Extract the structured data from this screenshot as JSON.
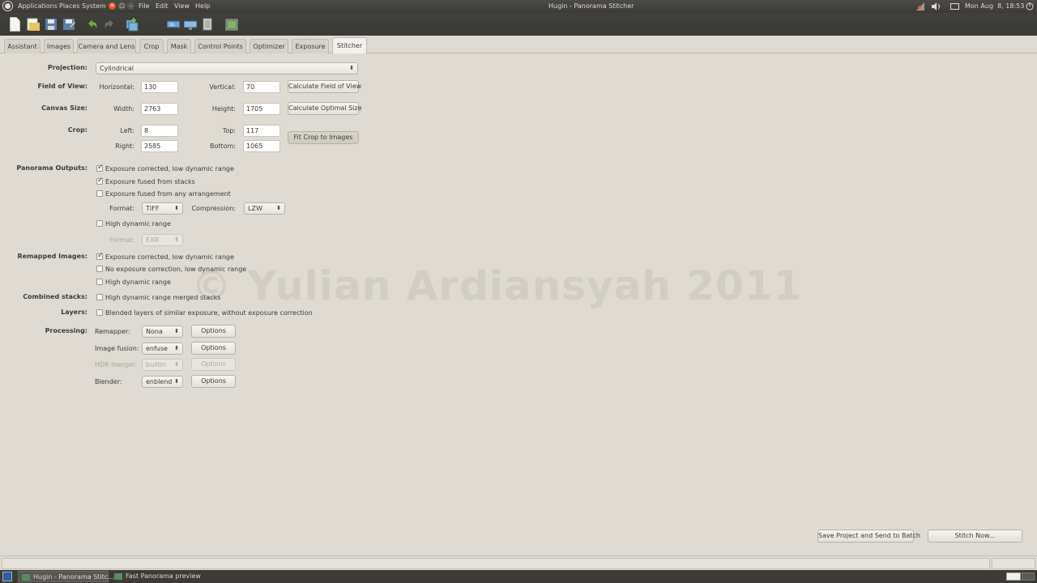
{
  "top_panel": {
    "menus": [
      "Applications",
      "Places",
      "System"
    ],
    "app_menus": [
      "File",
      "Edit",
      "View",
      "Help"
    ],
    "window_title": "Hugin - Panorama Stitcher",
    "clock": "Mon Aug  8, 18:53"
  },
  "tabs": [
    "Assistant",
    "Images",
    "Camera and Lens",
    "Crop",
    "Mask",
    "Control Points",
    "Optimizer",
    "Exposure",
    "Stitcher"
  ],
  "active_tab": "Stitcher",
  "projection": {
    "label": "Projection:",
    "value": "Cylindrical"
  },
  "field_of_view": {
    "label": "Field of View:",
    "horizontal_label": "Horizontal:",
    "horizontal": "130",
    "vertical_label": "Vertical:",
    "vertical": "70",
    "button": "Calculate Field of View"
  },
  "canvas_size": {
    "label": "Canvas Size:",
    "width_label": "Width:",
    "width": "2763",
    "height_label": "Height:",
    "height": "1705",
    "button": "Calculate Optimal Size"
  },
  "crop": {
    "label": "Crop:",
    "left_label": "Left:",
    "left": "8",
    "top_label": "Top:",
    "top": "117",
    "right_label": "Right:",
    "right": "2585",
    "bottom_label": "Bottom:",
    "bottom": "1065",
    "button": "Fit Crop to Images"
  },
  "panorama_outputs": {
    "label": "Panorama Outputs:",
    "options": [
      {
        "text": "Exposure corrected, low dynamic range",
        "checked": true
      },
      {
        "text": "Exposure fused from stacks",
        "checked": true
      },
      {
        "text": "Exposure fused from any arrangement",
        "checked": false
      }
    ],
    "format_label": "Format:",
    "format": "TIFF",
    "compression_label": "Compression:",
    "compression": "LZW",
    "hdr": {
      "text": "High dynamic range",
      "checked": false
    },
    "hdr_format_label": "Format:",
    "hdr_format": "EXR"
  },
  "remapped_images": {
    "label": "Remapped Images:",
    "options": [
      {
        "text": "Exposure corrected, low dynamic range",
        "checked": true
      },
      {
        "text": "No exposure correction, low dynamic range",
        "checked": false
      },
      {
        "text": "High dynamic range",
        "checked": false
      }
    ]
  },
  "combined_stacks": {
    "label": "Combined stacks:",
    "text": "High dynamic range merged stacks",
    "checked": false
  },
  "layers": {
    "label": "Layers:",
    "text": "Blended layers of similar exposure, without exposure correction",
    "checked": false
  },
  "processing": {
    "label": "Processing:",
    "rows": [
      {
        "label": "Remapper:",
        "value": "Nona",
        "button": "Options",
        "enabled": true
      },
      {
        "label": "Image fusion:",
        "value": "enfuse",
        "button": "Options",
        "enabled": true
      },
      {
        "label": "HDR merger:",
        "value": "builtin",
        "button": "Options",
        "enabled": false
      },
      {
        "label": "Blender:",
        "value": "enblend",
        "button": "Options",
        "enabled": true
      }
    ]
  },
  "watermark": "© Yulian Ardiansyah 2011",
  "bottom_buttons": {
    "batch": "Save Project and Send to Batch",
    "stitch": "Stitch Now..."
  },
  "taskbar": {
    "items": [
      "Hugin - Panorama Stitc...",
      "Fast Panorama preview"
    ]
  },
  "icons": {
    "toolbar": [
      "new-file-icon",
      "open-folder-icon",
      "save-icon",
      "save-as-icon",
      "undo-icon",
      "redo-icon",
      "add-images-icon",
      "fast-preview-icon",
      "preview-icon",
      "optimize-icon"
    ]
  }
}
